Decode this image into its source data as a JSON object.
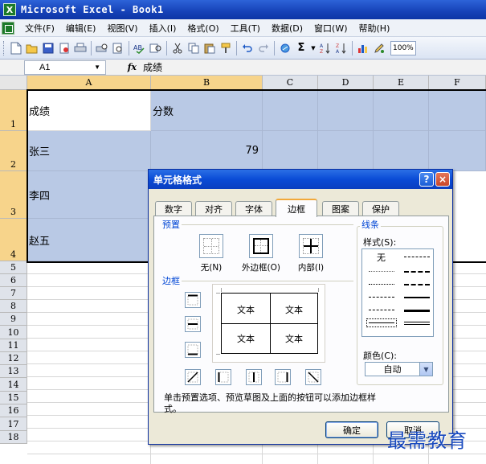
{
  "window": {
    "title": "Microsoft Excel - Book1"
  },
  "menu": [
    "文件(F)",
    "编辑(E)",
    "视图(V)",
    "插入(I)",
    "格式(O)",
    "工具(T)",
    "数据(D)",
    "窗口(W)",
    "帮助(H)"
  ],
  "toolbar": {
    "icons": [
      "new-icon",
      "open-icon",
      "save-icon",
      "permission-icon",
      "print-icon",
      "print-preview-icon",
      "spelling-icon",
      "research-icon",
      "cut-icon",
      "copy-icon",
      "paste-icon",
      "format-painter-icon",
      "undo-icon",
      "redo-icon",
      "hyperlink-icon",
      "autosum-icon",
      "sort-ascending-icon",
      "sort-descending-icon",
      "chart-wizard-icon",
      "drawing-icon"
    ],
    "zoom": "100%"
  },
  "formula_bar": {
    "name_box": "A1",
    "fx_symbol": "fx",
    "value": "成绩"
  },
  "sheet": {
    "columns": [
      "A",
      "B",
      "C",
      "D",
      "E",
      "F"
    ],
    "rows": [
      "1",
      "2",
      "3",
      "4",
      "5",
      "6",
      "7",
      "8",
      "9",
      "10",
      "11",
      "12",
      "13",
      "14",
      "15",
      "16",
      "17",
      "18"
    ],
    "cells": {
      "A1": "成绩",
      "B1": "分数",
      "A2": "张三",
      "B2": "79",
      "A3": "李四",
      "A4": "赵五"
    }
  },
  "dialog": {
    "title": "单元格格式",
    "help_button": "?",
    "close_button": "×",
    "tabs": [
      "数字",
      "对齐",
      "字体",
      "边框",
      "图案",
      "保护"
    ],
    "active_tab": "边框",
    "presets_label": "预置",
    "presets": [
      {
        "label": "无(N)",
        "icon": "border-none-icon"
      },
      {
        "label": "外边框(O)",
        "icon": "border-outline-icon"
      },
      {
        "label": "内部(I)",
        "icon": "border-inside-icon"
      }
    ],
    "border_label": "边框",
    "edge_buttons": [
      "border-top-icon",
      "border-middle-horizontal-icon",
      "border-bottom-icon",
      "border-diagonal-up-icon",
      "border-left-icon",
      "border-middle-vertical-icon",
      "border-right-icon",
      "border-diagonal-down-icon"
    ],
    "preview_text": [
      "文本",
      "文本",
      "文本",
      "文本"
    ],
    "line_label": "线条",
    "style_label": "样式(S):",
    "style_none": "无",
    "color_label": "颜色(C):",
    "color_value": "自动",
    "hint": "单击预置选项、预览草图及上面的按钮可以添加边框样式。",
    "ok_button": "确定",
    "cancel_button": "取消"
  },
  "watermark": "最需教育"
}
